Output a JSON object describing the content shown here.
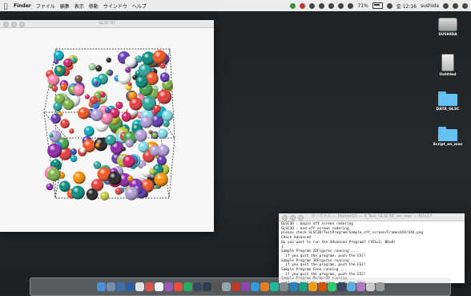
{
  "menubar": {
    "apple_icon": "apple-icon",
    "app_name": "Finder",
    "items": [
      "ファイル",
      "編集",
      "表示",
      "移動",
      "ウインドウ",
      "ヘルプ"
    ],
    "battery": "71%",
    "clock": "金 12:16",
    "user": "sushida"
  },
  "gl_window": {
    "title": "GLSC3D"
  },
  "terminal": {
    "title": "ターミナル — MarkerSD — 3_Test_GLSC3D_on_mac — 80×17",
    "lines": [
      "GLSC3D : begin off screen redering",
      "GLSC3D : end off screen redering",
      "please check GLSC3D/TestProgram/Sample_off_screen/FramesXXX/XXX.png",
      "Check Advanced",
      "Do you want to run the Advanced Program? (YES=1, NO=0)",
      "1",
      "Sample Program 2DFigures running ...",
      "  if you quit the program, push the ESC!",
      "Sample Program 3DFigures running ...",
      "  if you quit the program, push the ESC!",
      "Sample Program Cone running ...",
      "  if you quit the program, push the ESC!",
      "Sample Program Marker2D running ...",
      "  if you quit the program, push the ESC!",
      "Sample Program Marker3D running ...",
      "  if you quit the program, push the ESC!"
    ]
  },
  "desktop_icons": [
    {
      "label": "SUSHIDA",
      "icon": "hard-drive-icon"
    },
    {
      "label": "Untitled",
      "icon": "sd-card-icon"
    },
    {
      "label": "DATA_GLSC",
      "icon": "folder-icon"
    },
    {
      "label": "Script_on_mac",
      "icon": "folder-icon"
    }
  ],
  "dock_icon_colors": [
    "#4a90d9",
    "#6f8fb5",
    "#3d6fb0",
    "#2b5fa8",
    "#e0e0e0",
    "#d9534f",
    "#f5f5f5",
    "#9b59b6",
    "#e74c3c",
    "#27ae60",
    "#34495e",
    "#2c3e50",
    "#555555",
    "#95a5a6",
    "#c0392b",
    "#8e44ad",
    "#3498db",
    "#e67e22",
    "#1abc9c",
    "#7f8c8d",
    "#2980b9",
    "#16a085",
    "#f39c12",
    "#d35400",
    "#2ecc71",
    "#34495e",
    "#5dade2",
    "#af7ac5",
    "#cccccc",
    "#999999"
  ]
}
